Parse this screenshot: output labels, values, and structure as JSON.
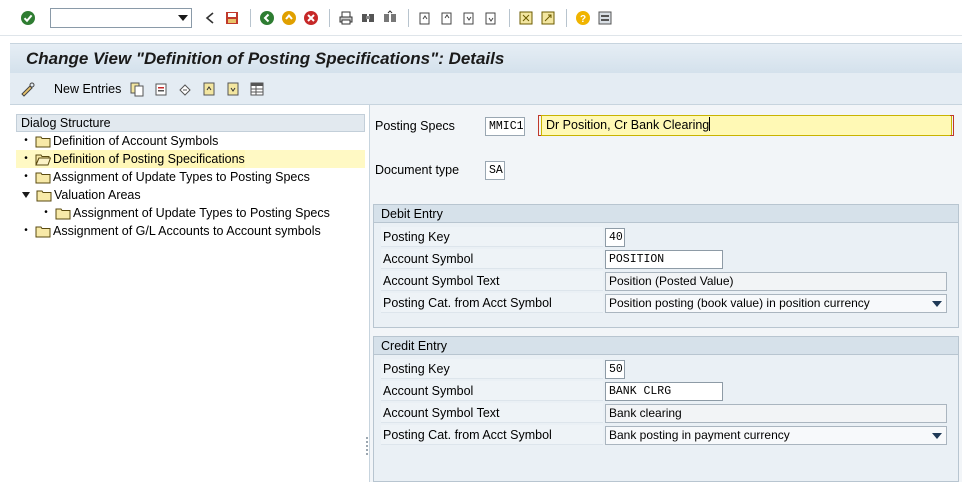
{
  "system_toolbar": {
    "command_field": {
      "value": "",
      "placeholder": ""
    },
    "icons": [
      "enter-icon",
      "back-icon",
      "save-icon",
      "navigate-back-icon",
      "exit-icon",
      "cancel-icon",
      "print-icon",
      "find-icon",
      "find-next-icon",
      "first-page-icon",
      "previous-page-icon",
      "next-page-icon",
      "last-page-icon",
      "create-session-icon",
      "shortcut-icon",
      "help-icon",
      "customize-layout-icon"
    ]
  },
  "title": "Change View \"Definition of Posting Specifications\": Details",
  "app_toolbar": {
    "new_entries_label": "New Entries"
  },
  "dialog_structure": {
    "header": "Dialog Structure",
    "items": [
      {
        "label": "Definition of Account Symbols"
      },
      {
        "label": "Definition of Posting Specifications"
      },
      {
        "label": "Assignment of Update Types to Posting Specs"
      },
      {
        "label": "Valuation Areas"
      },
      {
        "label": "Assignment of Update Types to Posting Specs"
      },
      {
        "label": "Assignment of G/L Accounts to Account symbols"
      }
    ]
  },
  "header_fields": {
    "posting_specs_label": "Posting Specs",
    "posting_specs_value": "MMIC1",
    "posting_specs_desc": "Dr Position, Cr Bank Clearing",
    "document_type_label": "Document type",
    "document_type_value": "SA"
  },
  "debit_entry": {
    "title": "Debit Entry",
    "posting_key_label": "Posting Key",
    "posting_key_value": "40",
    "account_symbol_label": "Account Symbol",
    "account_symbol_value": "POSITION",
    "account_symbol_text_label": "Account Symbol Text",
    "account_symbol_text_value": "Position (Posted Value)",
    "posting_cat_label": "Posting Cat. from Acct Symbol",
    "posting_cat_value": "Position posting (book value) in position currency"
  },
  "credit_entry": {
    "title": "Credit Entry",
    "posting_key_label": "Posting Key",
    "posting_key_value": "50",
    "account_symbol_label": "Account Symbol",
    "account_symbol_value": "BANK CLRG",
    "account_symbol_text_label": "Account Symbol Text",
    "account_symbol_text_value": "Bank clearing",
    "posting_cat_label": "Posting Cat. from Acct Symbol",
    "posting_cat_value": "Bank posting in payment currency"
  },
  "colors": {
    "title_bg": "#d4e1ec",
    "selected_row": "#fff9c4",
    "group_bg": "#eaf0f5",
    "highlight_field": "#fff9b5"
  }
}
